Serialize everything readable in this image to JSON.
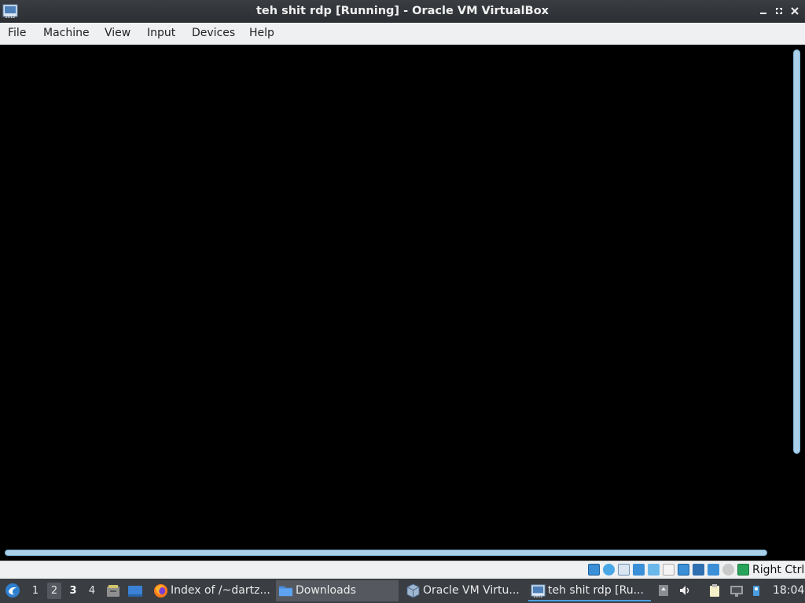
{
  "window": {
    "title": "teh shit rdp [Running] - Oracle VM VirtualBox",
    "app_icon": "virtualbox-vm-icon",
    "controls": [
      "minimize-icon",
      "restore-icon",
      "close-icon"
    ]
  },
  "menubar": {
    "items": [
      "File",
      "Machine",
      "View",
      "Input",
      "Devices",
      "Help"
    ]
  },
  "statusbar": {
    "icons": [
      "hard-disk-icon",
      "optical-drive-icon",
      "audio-icon",
      "network-icon",
      "usb-icon",
      "shared-folders-icon",
      "display-icon",
      "recording-icon",
      "vt-x-icon",
      "mouse-integration-icon",
      "keyboard-capture-icon"
    ],
    "host_key": "Right Ctrl"
  },
  "taskbar": {
    "start_icon": "start-menu-icon",
    "desktops": [
      "1",
      "2",
      "3",
      "4"
    ],
    "quick_launch": [
      "file-manager-icon",
      "show-desktop-icon"
    ],
    "tasks": [
      {
        "label": "Index of /~dartz...",
        "icon": "firefox-icon"
      },
      {
        "label": "Downloads",
        "icon": "folder-icon"
      },
      {
        "label": "Oracle VM Virtu...",
        "icon": "virtualbox-icon"
      },
      {
        "label": "teh shit rdp [Ru...",
        "icon": "virtualbox-vm-icon"
      }
    ],
    "tray": [
      "scroll-up-icon",
      "volume-icon",
      "clipboard-icon",
      "network-tray-icon",
      "update-notifier-icon"
    ],
    "clock": "18:04"
  },
  "colors": {
    "titlebar": "#2f3237",
    "menubar": "#eff0f1",
    "vm_display": "#000000",
    "scrollbar": "#a9cfe9",
    "taskbar": "#3a3d42",
    "accent": "#4a9ee0"
  }
}
